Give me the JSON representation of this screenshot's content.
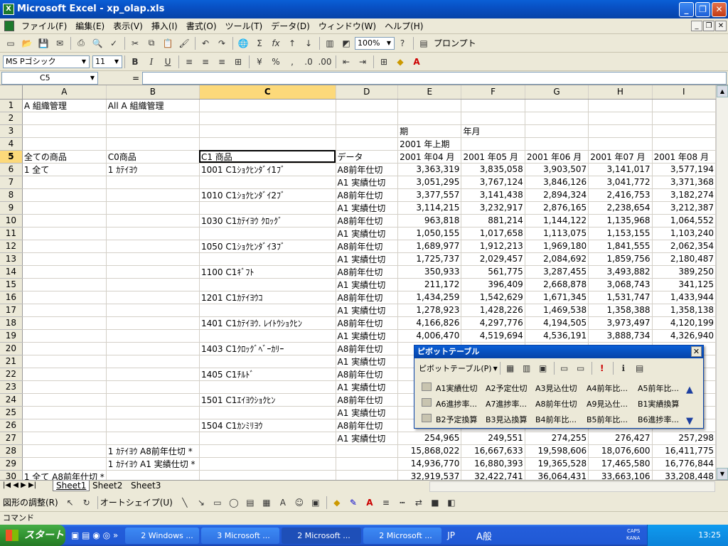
{
  "window": {
    "title": "Microsoft Excel - xp_olap.xls",
    "icon": "excel-icon"
  },
  "menu": [
    "ファイル(F)",
    "編集(E)",
    "表示(V)",
    "挿入(I)",
    "書式(O)",
    "ツール(T)",
    "データ(D)",
    "ウィンドウ(W)",
    "ヘルプ(H)"
  ],
  "toolbar": {
    "zoom": "100%",
    "prompt_label": "プロンプト"
  },
  "format": {
    "font": "MS Pゴシック",
    "size": "11"
  },
  "formula": {
    "cell": "C5",
    "eq": "=",
    "content": ""
  },
  "columns": [
    "A",
    "B",
    "C",
    "D",
    "E",
    "F",
    "G",
    "H",
    "I"
  ],
  "rows": [
    {
      "n": "1",
      "a": "A 組織管理",
      "b": "All A 組織管理",
      "c": "",
      "d": "",
      "v": [
        "",
        "",
        "",
        "",
        ""
      ]
    },
    {
      "n": "2",
      "a": "",
      "b": "",
      "c": "",
      "d": "",
      "v": [
        "",
        "",
        "",
        "",
        ""
      ]
    },
    {
      "n": "3",
      "a": "",
      "b": "",
      "c": "",
      "d": "",
      "v": [
        "期",
        "年月",
        "",
        "",
        ""
      ]
    },
    {
      "n": "4",
      "a": "",
      "b": "",
      "c": "",
      "d": "",
      "v": [
        "2001 年上期",
        "",
        "",
        "",
        ""
      ]
    },
    {
      "n": "5",
      "a": "全ての商品",
      "b": "C0商品",
      "c": "C1 商品",
      "d": "データ",
      "v": [
        "2001 年04 月",
        "2001 年05 月",
        "2001 年06 月",
        "2001 年07 月",
        "2001 年08 月"
      ]
    },
    {
      "n": "6",
      "a": "1 全て",
      "b": "1 ｶﾃｲﾖｳ",
      "c": "1001 C1ｼｮｸﾋﾝﾀﾞｲ1ﾌﾞ",
      "d": "A8前年仕切",
      "v": [
        "3,363,319",
        "3,835,058",
        "3,903,507",
        "3,141,017",
        "3,577,194"
      ]
    },
    {
      "n": "7",
      "a": "",
      "b": "",
      "c": "",
      "d": "A1 実績仕切",
      "v": [
        "3,051,295",
        "3,767,124",
        "3,846,126",
        "3,041,772",
        "3,371,368"
      ]
    },
    {
      "n": "8",
      "a": "",
      "b": "",
      "c": "1010 C1ｼｮｸﾋﾝﾀﾞｲ2ﾌﾞ",
      "d": "A8前年仕切",
      "v": [
        "3,377,557",
        "3,141,438",
        "2,894,324",
        "2,416,753",
        "3,182,274"
      ]
    },
    {
      "n": "9",
      "a": "",
      "b": "",
      "c": "",
      "d": "A1 実績仕切",
      "v": [
        "3,114,215",
        "3,232,917",
        "2,876,165",
        "2,238,654",
        "3,212,387"
      ]
    },
    {
      "n": "10",
      "a": "",
      "b": "",
      "c": "1030 C1ｶﾃｲﾖｳ ｸﾛｯｸﾞ",
      "d": "A8前年仕切",
      "v": [
        "963,818",
        "881,214",
        "1,144,122",
        "1,135,968",
        "1,064,552"
      ]
    },
    {
      "n": "11",
      "a": "",
      "b": "",
      "c": "",
      "d": "A1 実績仕切",
      "v": [
        "1,050,155",
        "1,017,658",
        "1,113,075",
        "1,153,155",
        "1,103,240"
      ]
    },
    {
      "n": "12",
      "a": "",
      "b": "",
      "c": "1050 C1ｼｮｸﾋﾝﾀﾞｲ3ﾌﾞ",
      "d": "A8前年仕切",
      "v": [
        "1,689,977",
        "1,912,213",
        "1,969,180",
        "1,841,555",
        "2,062,354"
      ]
    },
    {
      "n": "13",
      "a": "",
      "b": "",
      "c": "",
      "d": "A1 実績仕切",
      "v": [
        "1,725,737",
        "2,029,457",
        "2,084,692",
        "1,859,756",
        "2,180,487"
      ]
    },
    {
      "n": "14",
      "a": "",
      "b": "",
      "c": "1100 C1ｷﾞﾌﾄ",
      "d": "A8前年仕切",
      "v": [
        "350,933",
        "561,775",
        "3,287,455",
        "3,493,882",
        "389,250"
      ]
    },
    {
      "n": "15",
      "a": "",
      "b": "",
      "c": "",
      "d": "A1 実績仕切",
      "v": [
        "211,172",
        "396,409",
        "2,668,878",
        "3,068,743",
        "341,125"
      ]
    },
    {
      "n": "16",
      "a": "",
      "b": "",
      "c": "1201 C1ｶﾃｲﾖｳｺ",
      "d": "A8前年仕切",
      "v": [
        "1,434,259",
        "1,542,629",
        "1,671,345",
        "1,531,747",
        "1,433,944"
      ]
    },
    {
      "n": "17",
      "a": "",
      "b": "",
      "c": "",
      "d": "A1 実績仕切",
      "v": [
        "1,278,923",
        "1,428,226",
        "1,469,538",
        "1,358,388",
        "1,358,138"
      ]
    },
    {
      "n": "18",
      "a": "",
      "b": "",
      "c": "1401 C1ｶﾃｲﾖｳ. ﾚｲﾄｳｼｮｸﾋﾝ",
      "d": "A8前年仕切",
      "v": [
        "4,166,826",
        "4,297,776",
        "4,194,505",
        "3,973,497",
        "4,120,199"
      ]
    },
    {
      "n": "19",
      "a": "",
      "b": "",
      "c": "",
      "d": "A1 実績仕切",
      "v": [
        "4,006,470",
        "4,519,694",
        "4,536,191",
        "3,888,734",
        "4,326,940"
      ]
    },
    {
      "n": "20",
      "a": "",
      "b": "",
      "c": "1403 C1ｸﾛｯｸﾞﾍﾞｰｶﾘｰ",
      "d": "A8前年仕切",
      "v": [
        "",
        "",
        "",
        "",
        ""
      ]
    },
    {
      "n": "21",
      "a": "",
      "b": "",
      "c": "",
      "d": "A1 実績仕切",
      "v": [
        "",
        "",
        "",
        "",
        ""
      ]
    },
    {
      "n": "22",
      "a": "",
      "b": "",
      "c": "1405 C1ﾁﾙﾄﾞ",
      "d": "A8前年仕切",
      "v": [
        "",
        "",
        "",
        "",
        ""
      ]
    },
    {
      "n": "23",
      "a": "",
      "b": "",
      "c": "",
      "d": "A1 実績仕切",
      "v": [
        "",
        "",
        "",
        "",
        ""
      ]
    },
    {
      "n": "24",
      "a": "",
      "b": "",
      "c": "1501 C1ｴｲﾖｳｼｮｸﾋﾝ",
      "d": "A8前年仕切",
      "v": [
        "",
        "",
        "",
        "",
        ""
      ]
    },
    {
      "n": "25",
      "a": "",
      "b": "",
      "c": "",
      "d": "A1 実績仕切",
      "v": [
        "",
        "",
        "",
        "",
        ""
      ]
    },
    {
      "n": "26",
      "a": "",
      "b": "",
      "c": "1504 C1ｶﾝﾐﾘﾖｳ",
      "d": "A8前年仕切",
      "v": [
        "",
        "",
        "",
        "",
        ""
      ]
    },
    {
      "n": "27",
      "a": "",
      "b": "",
      "c": "",
      "d": "A1 実績仕切",
      "v": [
        "254,965",
        "249,551",
        "274,255",
        "276,427",
        "257,298"
      ]
    },
    {
      "n": "28",
      "a": "",
      "b": "1 ｶﾃｲﾖｳ A8前年仕切 *",
      "c": "",
      "d": "",
      "v": [
        "15,868,022",
        "16,667,633",
        "19,598,606",
        "18,076,600",
        "16,411,775"
      ]
    },
    {
      "n": "29",
      "a": "",
      "b": "1 ｶﾃｲﾖｳ A1 実績仕切 *",
      "c": "",
      "d": "",
      "v": [
        "14,936,770",
        "16,880,393",
        "19,365,528",
        "17,465,580",
        "16,776,844"
      ]
    },
    {
      "n": "30",
      "a": "1 全て A8前年仕切 *",
      "b": "",
      "c": "",
      "d": "",
      "v": [
        "32,919,537",
        "32,422,741",
        "36,064,431",
        "33,663,106",
        "33,208,448"
      ]
    }
  ],
  "sheets": [
    "Sheet1",
    "Sheet2",
    "Sheet3"
  ],
  "draw": {
    "adjust": "図形の調整(R)",
    "autoshape": "オートシェイプ(U)"
  },
  "status": "コマンド",
  "pivot": {
    "title": "ピボットテーブル",
    "menu": "ピボットテーブル(P)",
    "fields": [
      "A1実績仕切",
      "A2予定仕切",
      "A3見込仕切",
      "A4前年比...",
      "A5前年比...",
      "A6進捗率...",
      "A7進捗率...",
      "A8前年仕切",
      "A9見込仕...",
      "B1実績換算",
      "B2予定換算",
      "B3見込換算",
      "B4前年比...",
      "B5前年比...",
      "B6進捗率..."
    ]
  },
  "taskbar": {
    "start": "スタート",
    "tasks": [
      "2 Windows ...",
      "3 Microsoft ...",
      "2 Microsoft ...",
      "2 Microsoft ..."
    ],
    "lang": "JP",
    "ime": "A般",
    "clock": "13:25",
    "caps": "CAPS",
    "kana": "KANA"
  }
}
